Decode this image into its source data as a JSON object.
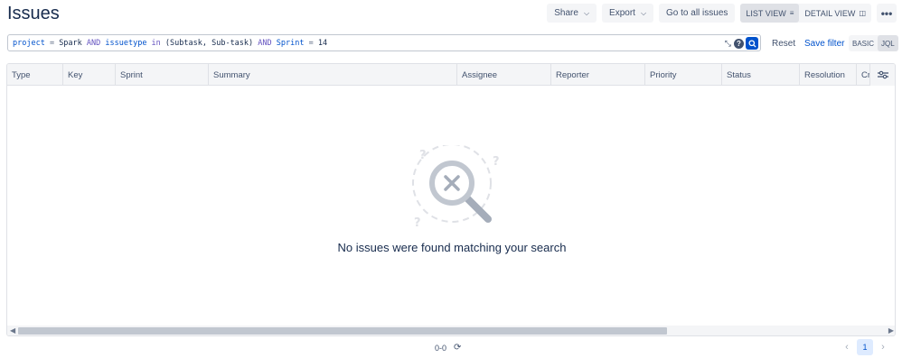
{
  "header": {
    "title": "Issues",
    "share_label": "Share",
    "export_label": "Export",
    "goto_label": "Go to all issues",
    "list_view_label": "LIST VIEW",
    "detail_view_label": "DETAIL VIEW",
    "more_label": "•••"
  },
  "jql": {
    "tokens": {
      "t1": "project",
      "t2": " = ",
      "t3": "Spark",
      "t4": " AND ",
      "t5": "issuetype",
      "t6": " in ",
      "t7": "(Subtask, Sub-task)",
      "t8": " AND ",
      "t9": "Sprint",
      "t10": " = ",
      "t11": "14"
    },
    "help_label": "?",
    "reset_label": "Reset",
    "save_label": "Save filter",
    "basic_label": "BASIC",
    "jql_label": "JQL"
  },
  "table": {
    "columns": [
      "Type",
      "Key",
      "Sprint",
      "Summary",
      "Assignee",
      "Reporter",
      "Priority",
      "Status",
      "Resolution",
      "Cr"
    ],
    "empty_message": "No issues were found matching your search"
  },
  "footer": {
    "count": "0-0",
    "current_page": "1"
  }
}
